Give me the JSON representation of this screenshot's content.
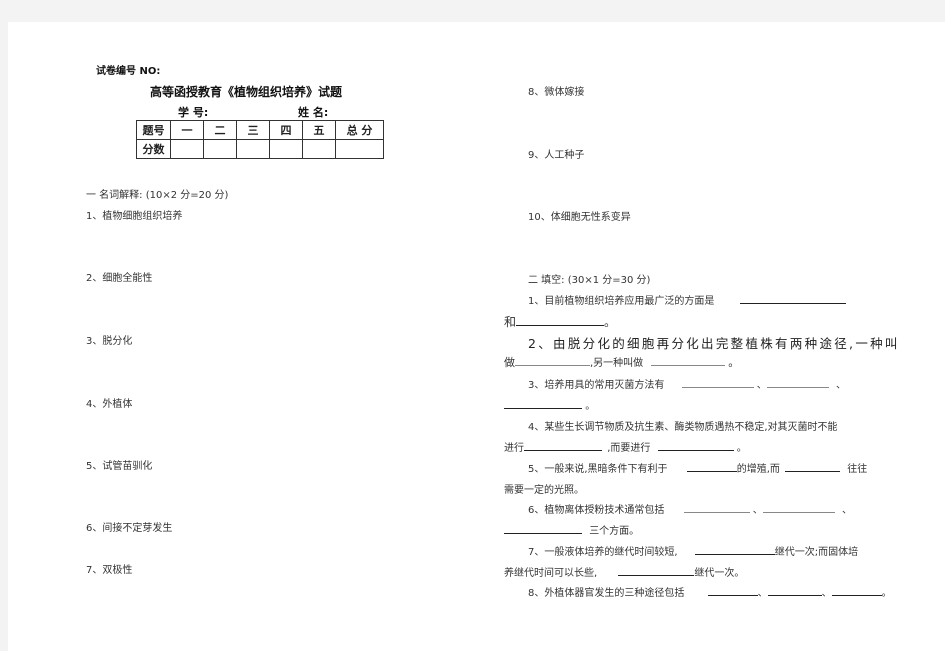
{
  "header": {
    "paper_no_label": "试卷编号 NO:",
    "title": "高等函授教育《植物组织培养》试题",
    "student_id_label": "学  号:",
    "name_label": "姓  名:"
  },
  "score_table": {
    "header_row": [
      "题号",
      "一",
      "二",
      "三",
      "四",
      "五",
      "总  分"
    ],
    "score_row_label": "分数"
  },
  "section1": {
    "title": "一  名词解释: (10×2 分=20 分)",
    "items": [
      "1、植物细胞组织培养",
      "2、细胞全能性",
      "3、脱分化",
      "4、外植体",
      "5、试管苗驯化",
      "6、间接不定芽发生",
      "7、双极性",
      "8、微体嫁接",
      "9、人工种子",
      "10、体细胞无性系变异"
    ]
  },
  "section2": {
    "title": "二  填空: (30×1 分=30 分)",
    "q1": {
      "a": "1、目前植物组织培养应用最广泛的方面是",
      "b": "和",
      "end": "。"
    },
    "q2": {
      "a": "2、由脱分化的细胞再分化出完整植株有两种途径,一种叫",
      "b": "做",
      "mid": ",另一种叫做",
      "end": "。"
    },
    "q3": {
      "a": "3、培养用具的常用灭菌方法有",
      "sep": "、",
      "end": "。"
    },
    "q4": {
      "a": "4、某些生长调节物质及抗生素、酶类物质遇热不稳定,对其灭菌时不能",
      "b": "进行",
      "mid": ",而要进行",
      "end": "。"
    },
    "q5": {
      "a": "5、一般来说,黑暗条件下有利于",
      "mid": "的增殖,而",
      "tail": "往往",
      "b": "需要一定的光照。"
    },
    "q6": {
      "a": "6、植物离体授粉技术通常包括",
      "sep": "、",
      "end": "三个方面。"
    },
    "q7": {
      "a": "7、一般液体培养的继代时间较短,",
      "mid": "继代一次;而固体培",
      "b": "养继代时间可以长些,",
      "end": "继代一次。"
    },
    "q8": {
      "a": "8、外植体器官发生的三种途径包括",
      "sep": "、",
      "end": "。"
    }
  }
}
